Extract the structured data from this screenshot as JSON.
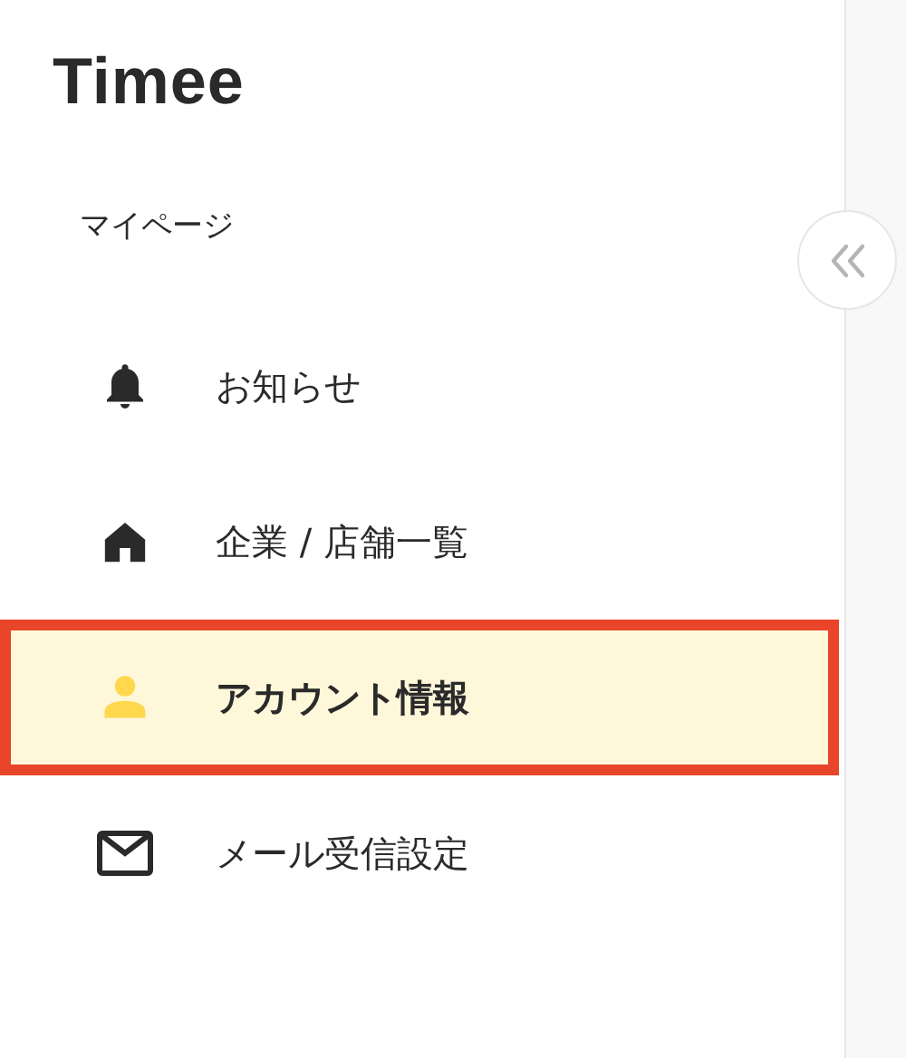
{
  "logo": "Timee",
  "section_title": "マイページ",
  "menu": [
    {
      "kind": "bell",
      "label": "お知らせ",
      "selected": false
    },
    {
      "kind": "home",
      "label": "企業 / 店舗一覧",
      "selected": false
    },
    {
      "kind": "person",
      "label": "アカウント情報",
      "selected": true
    },
    {
      "kind": "mail",
      "label": "メール受信設定",
      "selected": false
    }
  ]
}
